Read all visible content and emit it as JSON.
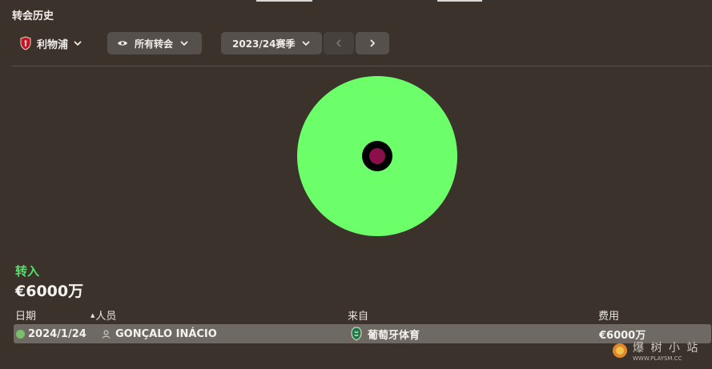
{
  "header": {
    "title": "转会历史"
  },
  "toolbar": {
    "club_name": "利物浦",
    "filter_label": "所有转会",
    "season_label": "2023/24赛季"
  },
  "chart_data": {
    "type": "pie",
    "categories": [
      "转入"
    ],
    "values": [
      100
    ],
    "colors": [
      "#6cff6a"
    ],
    "center_color": "#8a0f4a"
  },
  "section": {
    "label": "转入",
    "total": "€6000万"
  },
  "table": {
    "columns": {
      "date": "日期",
      "person": "人员",
      "from": "来自",
      "fee": "费用"
    },
    "rows": [
      {
        "date": "2024/1/24",
        "person": "GONÇALO INÁCIO",
        "from": "葡萄牙体育",
        "fee": "€6000万"
      }
    ]
  },
  "colors": {
    "accent_green": "#56e06a",
    "background": "#3b322c"
  }
}
